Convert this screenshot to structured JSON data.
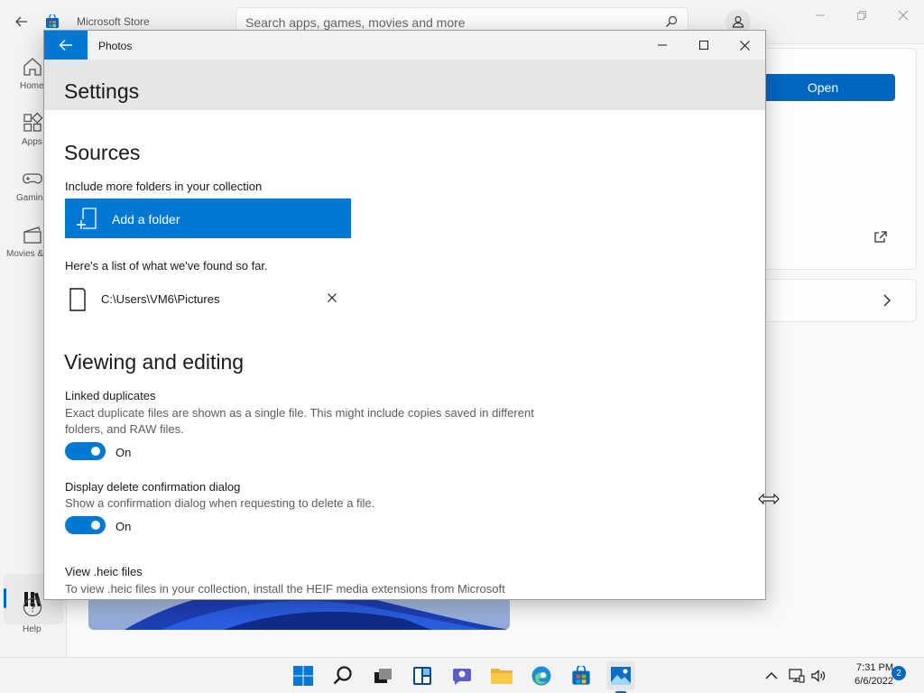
{
  "store": {
    "title": "Microsoft Store",
    "search_placeholder": "Search apps, games, movies and more",
    "nav": [
      {
        "label": "Home",
        "icon": "home-icon"
      },
      {
        "label": "Apps",
        "icon": "apps-icon"
      },
      {
        "label": "Gaming",
        "icon": "gaming-icon"
      },
      {
        "label": "Movies & TV",
        "icon": "movies-icon"
      }
    ],
    "help_label": "Help",
    "open_label": "Open"
  },
  "photos": {
    "app_title": "Photos",
    "page_title": "Settings",
    "sources": {
      "heading": "Sources",
      "include_text": "Include more folders in your collection",
      "add_folder_label": "Add a folder",
      "found_text": "Here's a list of what we've found so far.",
      "folders": [
        "C:\\Users\\VM6\\Pictures"
      ]
    },
    "viewing": {
      "heading": "Viewing and editing",
      "linked_title": "Linked duplicates",
      "linked_desc": "Exact duplicate files are shown as a single file. This might include copies saved in different folders, and RAW files.",
      "linked_state": "On",
      "delete_title": "Display delete confirmation dialog",
      "delete_desc": "Show a confirmation dialog when requesting to delete a file.",
      "delete_state": "On",
      "heic_title": "View .heic files",
      "heic_desc": "To view .heic files in your collection, install the HEIF media extensions from Microsoft"
    }
  },
  "taskbar": {
    "time": "7:31 PM",
    "date": "6/6/2022",
    "notifications": "2"
  },
  "colors": {
    "accent": "#0078d4",
    "store_accent": "#0067c0"
  }
}
